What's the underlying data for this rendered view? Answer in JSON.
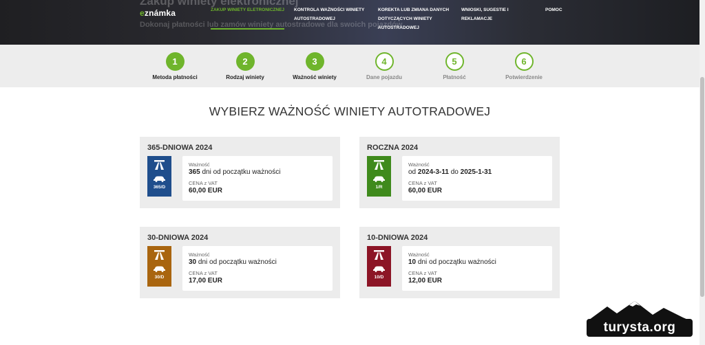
{
  "header": {
    "bg_title": "Zakup winiety elektronicznej",
    "bg_subtitle": "Dokonaj płatności lub zamów winiety autostradowe dla swoich pojazdów",
    "logo_prefix": "e",
    "logo_rest": "známka",
    "nav": [
      {
        "label_lines": [
          "ZAKUP WINIETY ELETRONICZNEJ"
        ]
      },
      {
        "label_lines": [
          "KONTROLA WAŻNOŚCI WINIETY",
          "AUTOSTRADOWEJ"
        ]
      },
      {
        "label_lines": [
          "KOREKTA LUB ZMIANA DANYCH",
          "DOTYCZĄCYCH WINIETY",
          "AUTOSTRADOWEJ"
        ]
      },
      {
        "label_lines": [
          "WNIOSKI, SUGESTIE I",
          "REKLAMACJE"
        ]
      },
      {
        "label_lines": [
          "POMOC"
        ]
      }
    ]
  },
  "steps": [
    {
      "number": "1",
      "label": "Metoda płatności",
      "state": "done"
    },
    {
      "number": "2",
      "label": "Rodzaj winiety",
      "state": "done"
    },
    {
      "number": "3",
      "label": "Ważność winiety",
      "state": "done"
    },
    {
      "number": "4",
      "label": "Dane pojazdu",
      "state": "todo"
    },
    {
      "number": "5",
      "label": "Płatność",
      "state": "todo"
    },
    {
      "number": "6",
      "label": "Potwierdzenie",
      "state": "todo"
    }
  ],
  "page_title": "WYBIERZ WAŻNOŚĆ WINIETY AUTOTRADOWEJ",
  "cards": [
    {
      "title": "365-DNIOWA 2024",
      "badge_code": "365/D",
      "badge_color": "#1f4e8c",
      "validity_label": "Ważność",
      "validity": {
        "parts": [
          {
            "t": "365",
            "b": true
          },
          {
            "t": " dni od początku ważności",
            "b": false
          }
        ]
      },
      "price_label": "CENA z VAT",
      "price": "60,00 EUR"
    },
    {
      "title": "ROCZNA 2024",
      "badge_code": "1/R",
      "badge_color": "#3f8a1c",
      "validity_label": "Ważność",
      "validity": {
        "parts": [
          {
            "t": "od ",
            "b": false
          },
          {
            "t": "2024-3-11",
            "b": true
          },
          {
            "t": " do ",
            "b": false
          },
          {
            "t": "2025-1-31",
            "b": true
          }
        ]
      },
      "price_label": "CENA z VAT",
      "price": "60,00 EUR"
    },
    {
      "title": "30-DNIOWA 2024",
      "badge_code": "30/D",
      "badge_color": "#a9650f",
      "validity_label": "Ważność",
      "validity": {
        "parts": [
          {
            "t": "30",
            "b": true
          },
          {
            "t": " dni od początku ważności",
            "b": false
          }
        ]
      },
      "price_label": "CENA z VAT",
      "price": "17,00 EUR"
    },
    {
      "title": "10-DNIOWA 2024",
      "badge_code": "10/D",
      "badge_color": "#8c1526",
      "validity_label": "Ważność",
      "validity": {
        "parts": [
          {
            "t": "10",
            "b": true
          },
          {
            "t": " dni od początku ważności",
            "b": false
          }
        ]
      },
      "price_label": "CENA z VAT",
      "price": "12,00 EUR"
    }
  ],
  "watermark": {
    "text": "turysta.org"
  },
  "colors": {
    "accent": "#6fb52c"
  }
}
